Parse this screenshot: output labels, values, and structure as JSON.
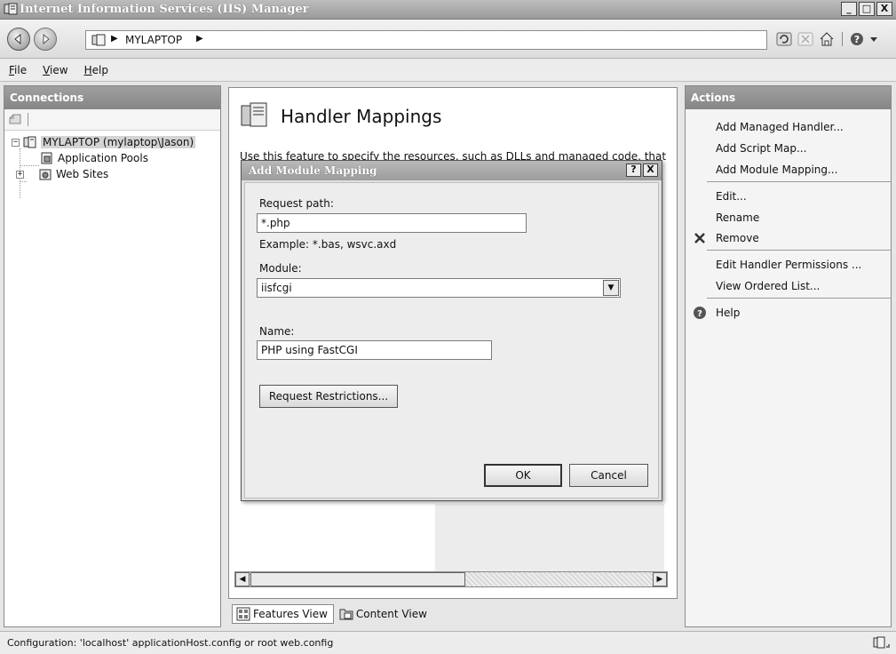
{
  "window": {
    "title": "Internet Information Services (IIS) Manager",
    "controls": {
      "minimize": "_",
      "maximize": "□",
      "close": "X"
    }
  },
  "navbar": {
    "address_segments": [
      "MYLAPTOP"
    ],
    "separator": "▶"
  },
  "menu": {
    "file": {
      "mnemonic": "F",
      "rest": "ile"
    },
    "view": {
      "mnemonic": "V",
      "rest": "iew"
    },
    "help": {
      "mnemonic": "H",
      "rest": "elp"
    }
  },
  "connections": {
    "title": "Connections",
    "tree": {
      "root": "MYLAPTOP (mylaptop\\Jason)",
      "children": [
        "Application Pools",
        "Web Sites"
      ]
    }
  },
  "feature": {
    "title": "Handler Mappings",
    "description": "Use this feature to specify the resources, such as DLLs and managed code, that"
  },
  "view_tabs": {
    "features": "Features View",
    "content": "Content View"
  },
  "actions": {
    "title": "Actions",
    "group1": [
      "Add Managed Handler...",
      "Add Script Map...",
      "Add Module Mapping..."
    ],
    "group2": [
      "Edit...",
      "Rename",
      "Remove"
    ],
    "group3": [
      "Edit Handler Permissions ...",
      "View Ordered List..."
    ],
    "group4": [
      "Help"
    ]
  },
  "dialog": {
    "title": "Add Module Mapping",
    "help_btn": "?",
    "close_btn": "X",
    "request_path_label": "Request path:",
    "request_path_value": "*.php",
    "example_text": "Example: *.bas, wsvc.axd",
    "module_label": "Module:",
    "module_value": "iisfcgi",
    "name_label": "Name:",
    "name_value": "PHP using FastCGI",
    "restrictions_btn": "Request Restrictions...",
    "ok_btn": "OK",
    "cancel_btn": "Cancel"
  },
  "status": {
    "text": "Configuration: 'localhost' applicationHost.config or root web.config"
  }
}
